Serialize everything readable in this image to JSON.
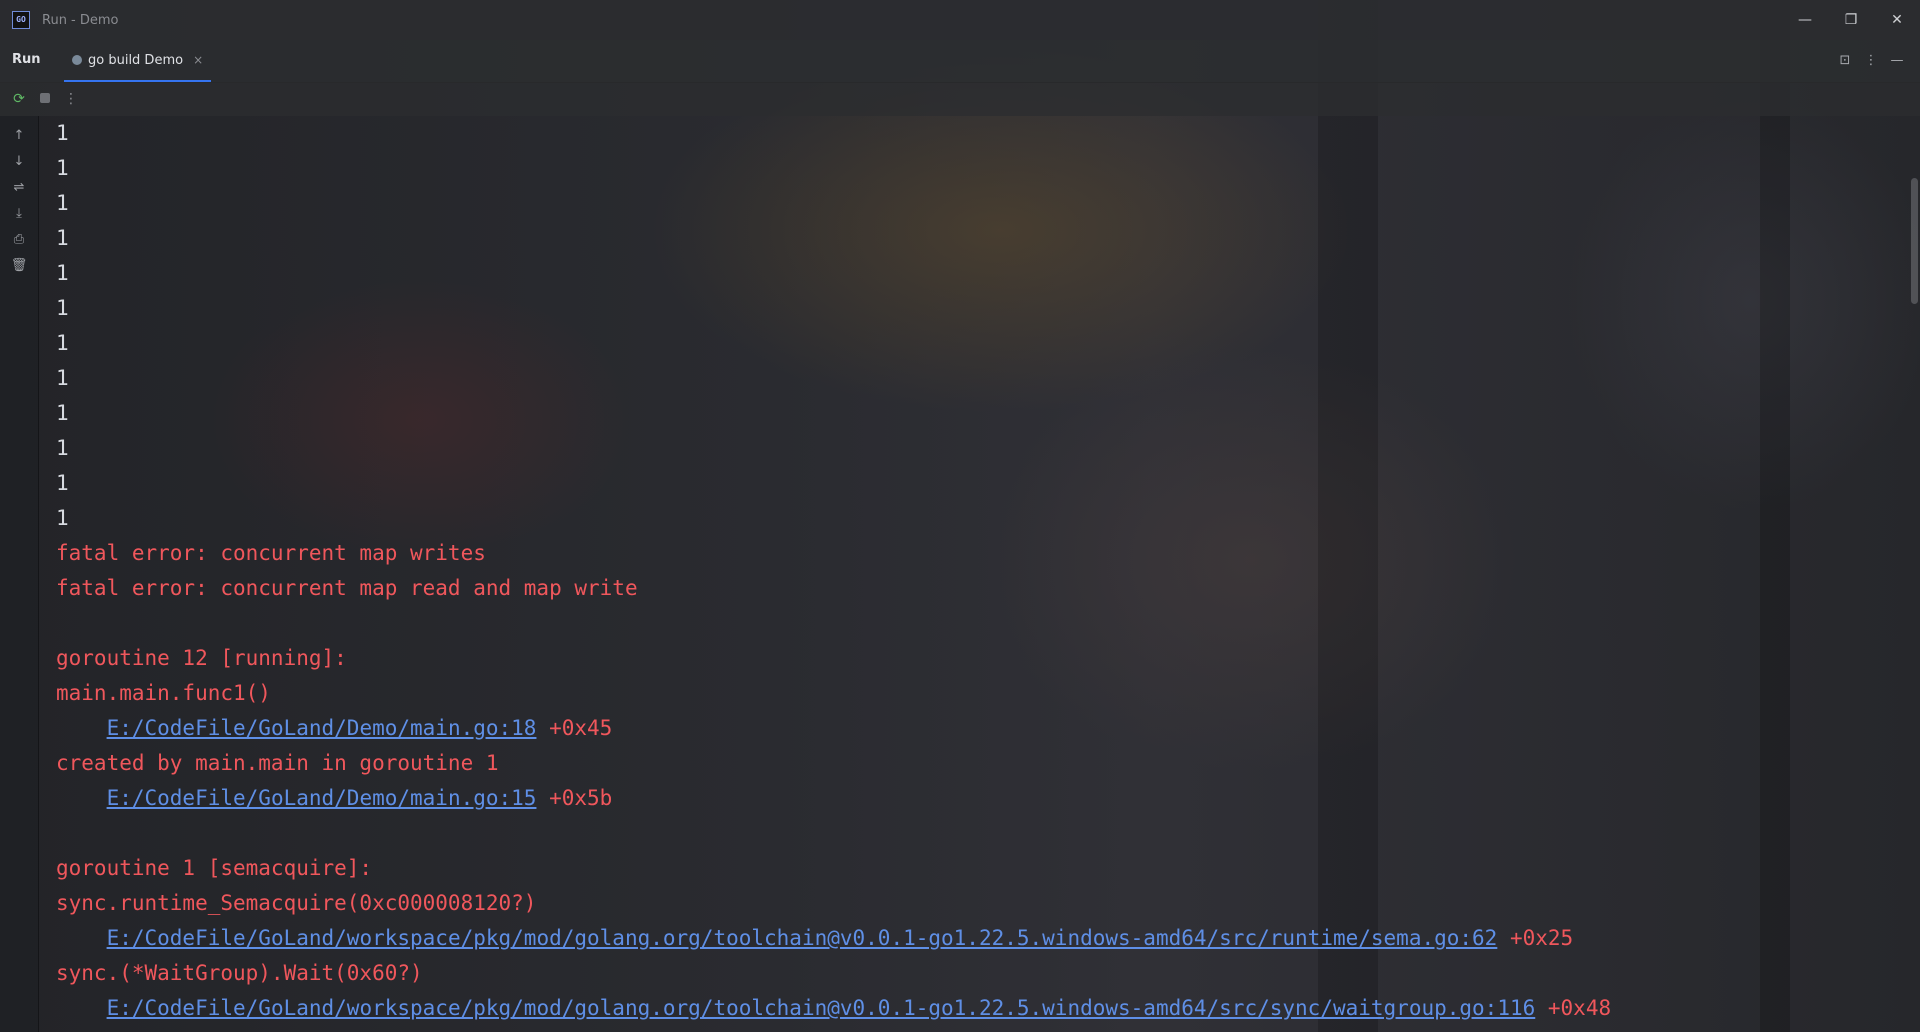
{
  "window": {
    "logo_text": "GO",
    "title": "Run - Demo",
    "minimize": "—",
    "restore": "❐",
    "close": "✕"
  },
  "tool_window": {
    "name": "Run",
    "tab_label": "go build Demo",
    "tab_close": "×",
    "header_icons": [
      "⊡",
      "⋮",
      "—"
    ]
  },
  "actions": {
    "rerun": "⟳",
    "more": "⋮"
  },
  "gutter_icons": [
    {
      "name": "scroll-up-icon",
      "glyph": "↑"
    },
    {
      "name": "scroll-down-icon",
      "glyph": "↓"
    },
    {
      "name": "soft-wrap-icon",
      "glyph": "⇌"
    },
    {
      "name": "scroll-to-end-icon",
      "glyph": "⤓"
    },
    {
      "name": "print-icon",
      "glyph": "⎙"
    },
    {
      "name": "clear-all-icon",
      "glyph": "🗑"
    }
  ],
  "console": {
    "output_lines": [
      "1",
      "1",
      "1",
      "1",
      "1",
      "1",
      "1",
      "1",
      "1",
      "1",
      "1",
      "1"
    ],
    "error_lines": [
      {
        "segments": [
          {
            "text": "fatal error: concurrent map writes",
            "kind": "err"
          }
        ]
      },
      {
        "segments": [
          {
            "text": "fatal error: concurrent map read and map write",
            "kind": "err"
          }
        ]
      },
      {
        "segments": []
      },
      {
        "segments": [
          {
            "text": "goroutine 12 [running]:",
            "kind": "err"
          }
        ]
      },
      {
        "segments": [
          {
            "text": "main.main.func1()",
            "kind": "err"
          }
        ]
      },
      {
        "segments": [
          {
            "text": "    ",
            "kind": "err"
          },
          {
            "text": "E:/CodeFile/GoLand/Demo/main.go:18",
            "kind": "link"
          },
          {
            "text": " +0x45",
            "kind": "err"
          }
        ]
      },
      {
        "segments": [
          {
            "text": "created by main.main in goroutine 1",
            "kind": "err"
          }
        ]
      },
      {
        "segments": [
          {
            "text": "    ",
            "kind": "err"
          },
          {
            "text": "E:/CodeFile/GoLand/Demo/main.go:15",
            "kind": "link"
          },
          {
            "text": " +0x5b",
            "kind": "err"
          }
        ]
      },
      {
        "segments": []
      },
      {
        "segments": [
          {
            "text": "goroutine 1 [semacquire]:",
            "kind": "err"
          }
        ]
      },
      {
        "segments": [
          {
            "text": "sync.runtime_Semacquire(0xc000008120?)",
            "kind": "err"
          }
        ]
      },
      {
        "segments": [
          {
            "text": "    ",
            "kind": "err"
          },
          {
            "text": "E:/CodeFile/GoLand/workspace/pkg/mod/golang.org/toolchain@v0.0.1-go1.22.5.windows-amd64/src/runtime/sema.go:62",
            "kind": "link"
          },
          {
            "text": " +0x25",
            "kind": "err"
          }
        ]
      },
      {
        "segments": [
          {
            "text": "sync.(*WaitGroup).Wait(0x60?)",
            "kind": "err"
          }
        ]
      },
      {
        "segments": [
          {
            "text": "    ",
            "kind": "err"
          },
          {
            "text": "E:/CodeFile/GoLand/workspace/pkg/mod/golang.org/toolchain@v0.0.1-go1.22.5.windows-amd64/src/sync/waitgroup.go:116",
            "kind": "link"
          },
          {
            "text": " +0x48",
            "kind": "err"
          }
        ]
      }
    ]
  }
}
